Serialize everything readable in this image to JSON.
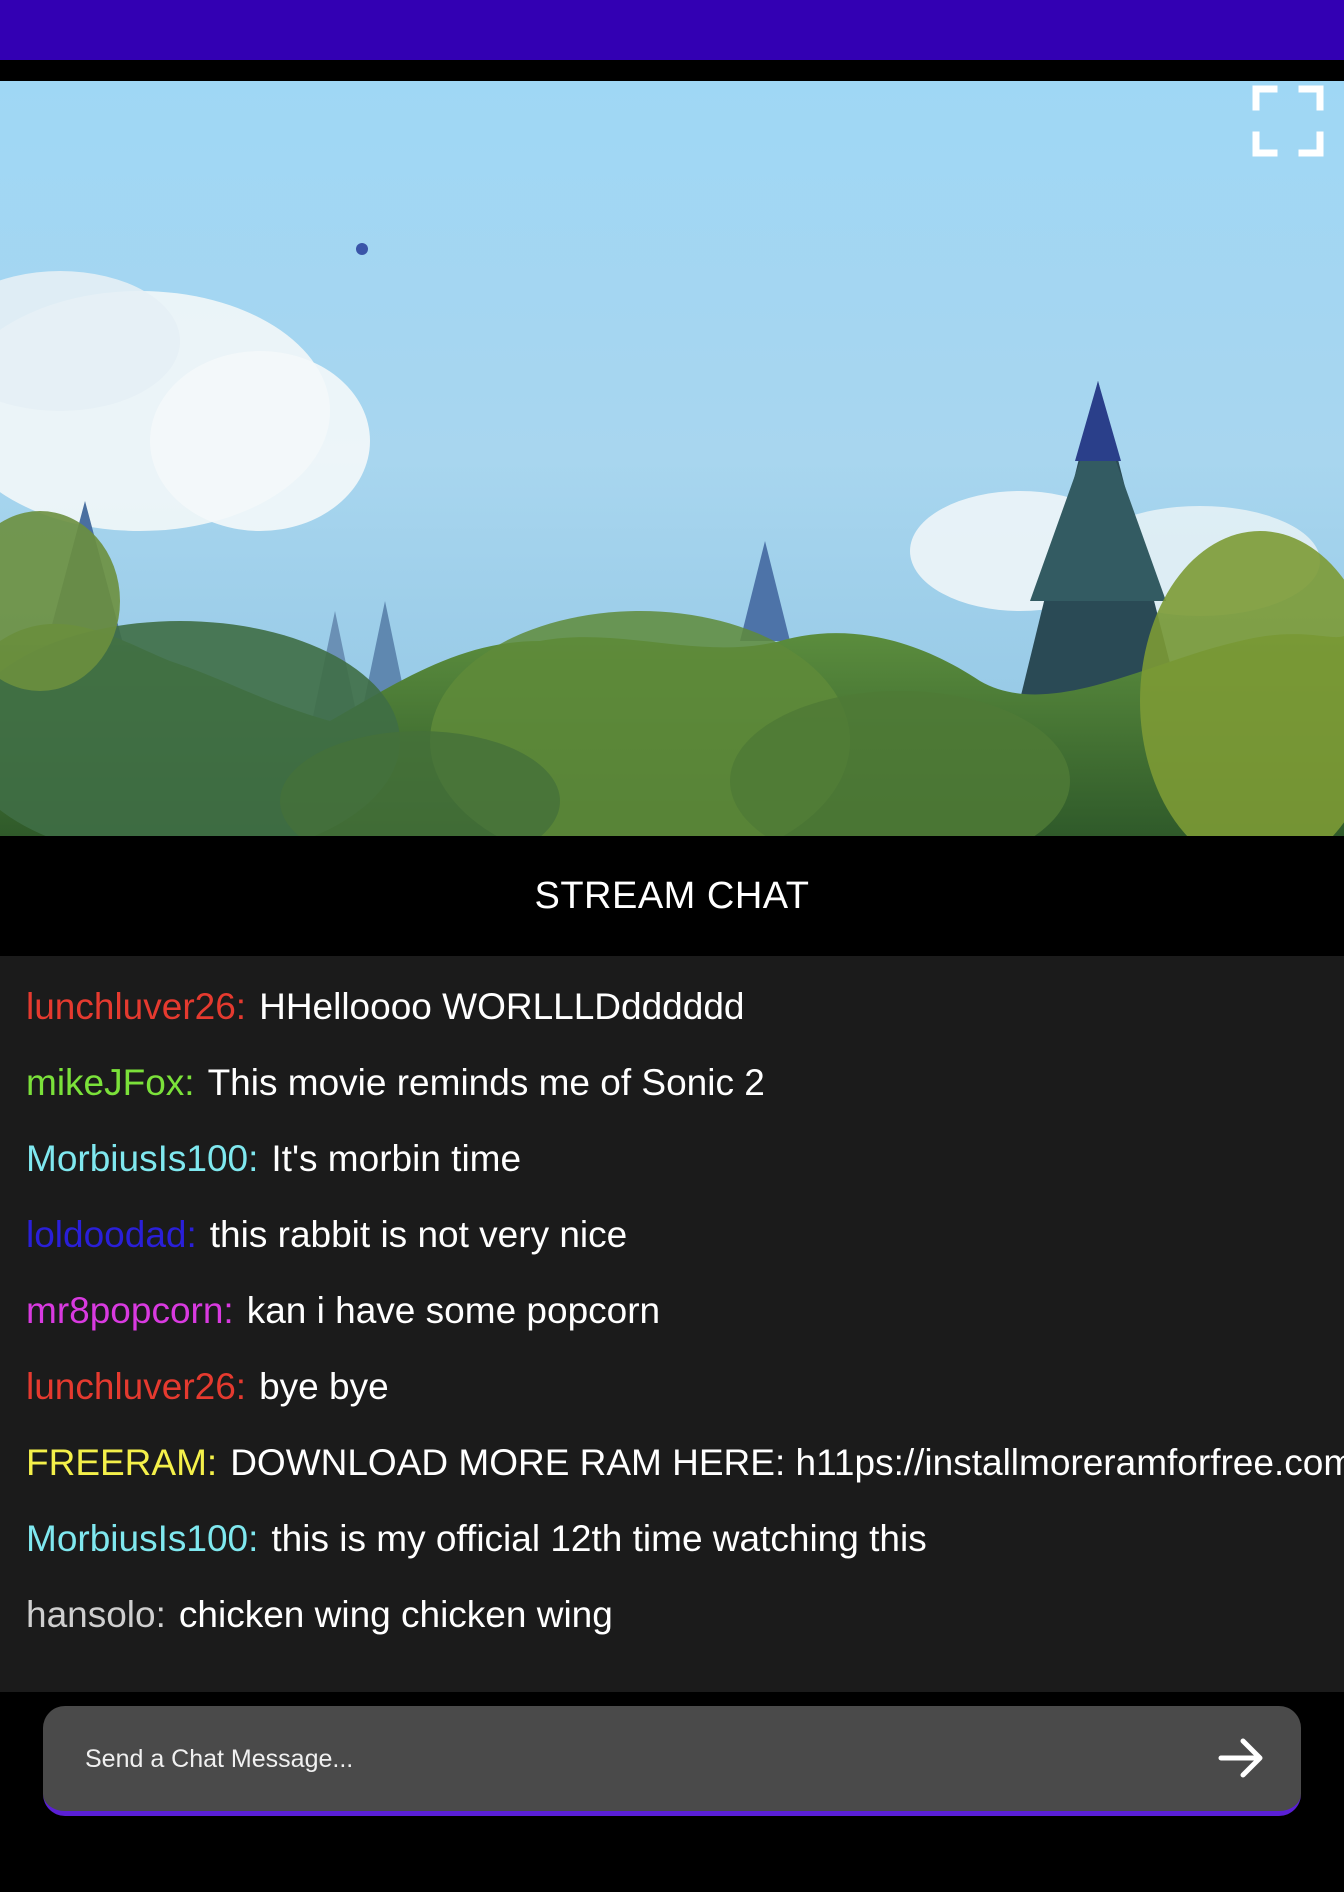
{
  "colors": {
    "top_bar": "#3300b3",
    "chat_background": "#1b1b1b",
    "input_background": "#4a4a4a",
    "input_underline": "#5a1fd6"
  },
  "video": {
    "fullscreen_icon": "fullscreen-icon"
  },
  "chat": {
    "title": "STREAM CHAT",
    "messages": [
      {
        "user": "lunchluver26:",
        "text": "HHelloooo WORLLLDdddddd",
        "color": "#e53a2f"
      },
      {
        "user": "mikeJFox:",
        "text": "This movie reminds me of Sonic 2",
        "color": "#7be13a"
      },
      {
        "user": "MorbiusIs100:",
        "text": "It's morbin time",
        "color": "#7fe8ef"
      },
      {
        "user": "loldoodad:",
        "text": "this rabbit is not very nice",
        "color": "#2a1fd9"
      },
      {
        "user": "mr8popcorn:",
        "text": "kan i have some popcorn",
        "color": "#d93ae0"
      },
      {
        "user": "lunchluver26:",
        "text": "bye bye",
        "color": "#e53a2f"
      },
      {
        "user": "FREERAM:",
        "text": "DOWNLOAD MORE RAM HERE: h11ps://installmoreramforfree.com",
        "color": "#f4f04a"
      },
      {
        "user": "MorbiusIs100:",
        "text": "this is my official 12th time watching this",
        "color": "#7fe8ef"
      },
      {
        "user": "hansolo:",
        "text": "chicken wing chicken wing",
        "color": "#cfcfcf"
      }
    ]
  },
  "input": {
    "placeholder": "Send a Chat Message...",
    "value": "",
    "send_icon": "arrow-right-icon"
  }
}
